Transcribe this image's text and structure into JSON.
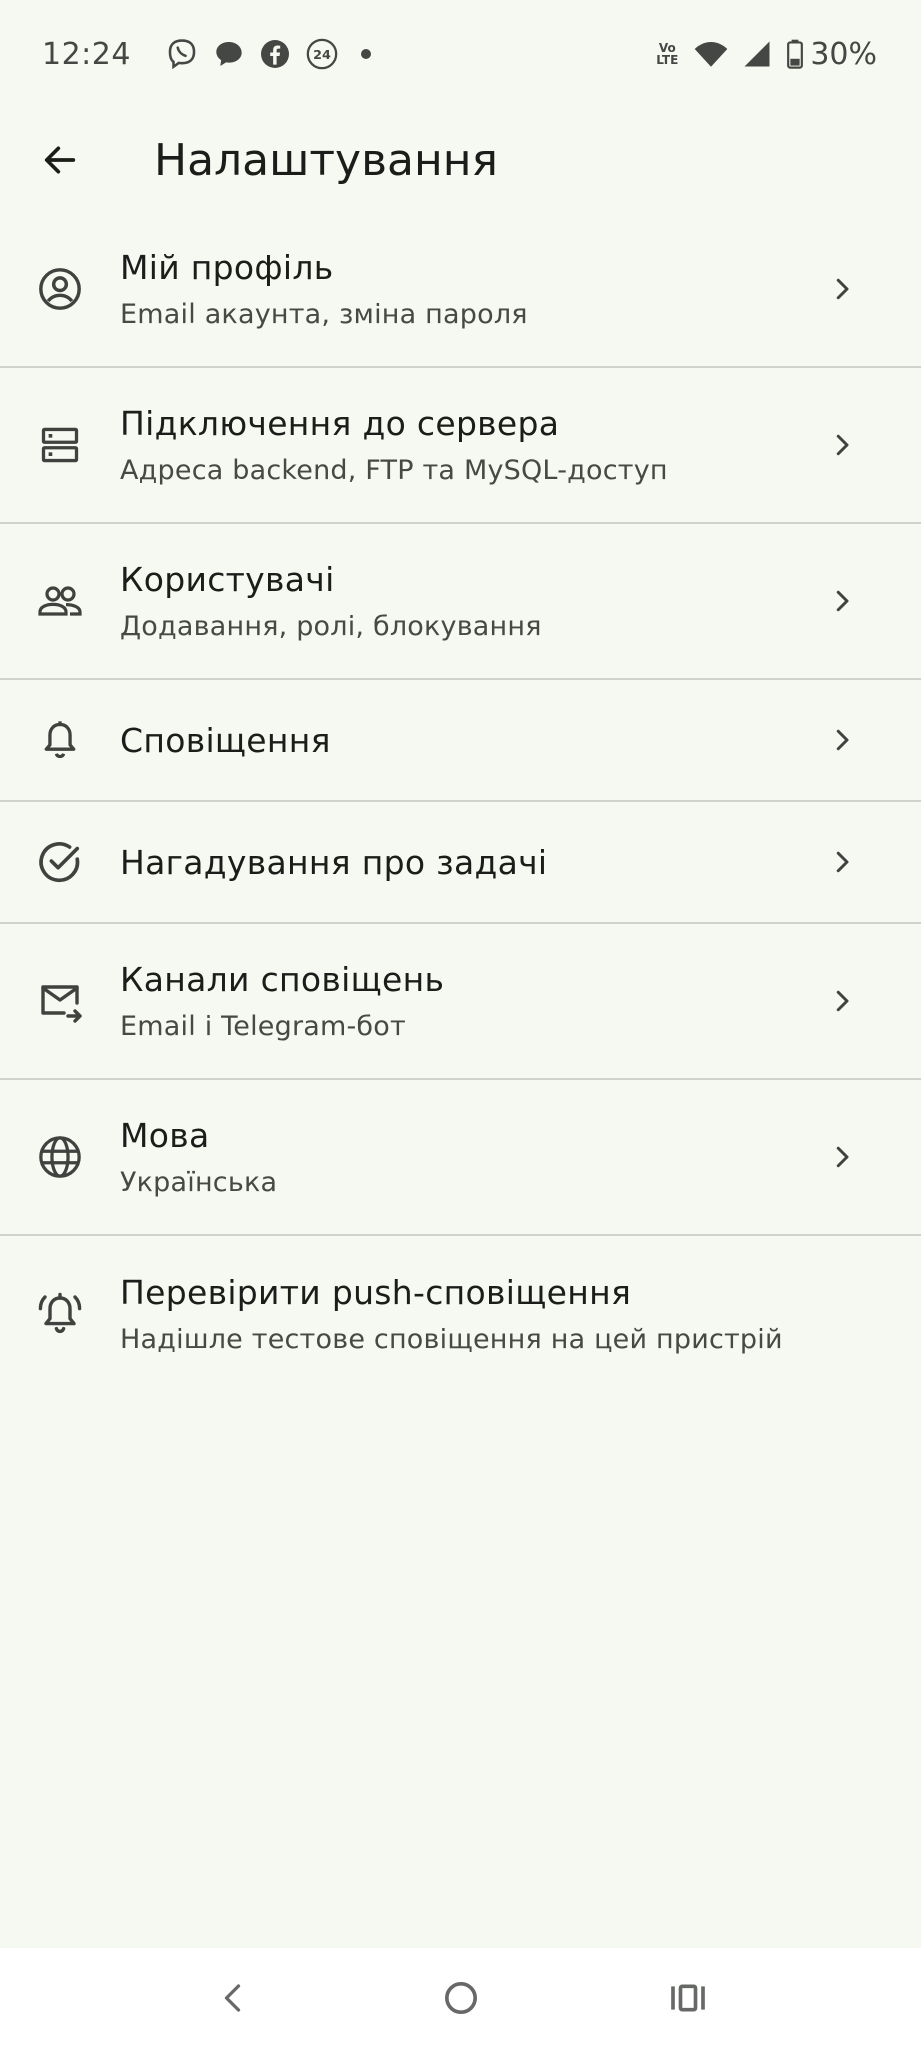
{
  "status_bar": {
    "time": "12:24",
    "notification_icons": [
      "viber-icon",
      "chat-bubble-icon",
      "facebook-icon",
      "24-badge-icon"
    ],
    "network_label_top": "Vo",
    "network_label_bottom": "LTE",
    "battery_percent": "30%"
  },
  "app_bar": {
    "title": "Налаштування"
  },
  "settings": {
    "items": [
      {
        "icon": "account-circle-icon",
        "title": "Мій профіль",
        "subtitle": "Email акаунта, зміна пароля"
      },
      {
        "icon": "server-icon",
        "title": "Підключення до сервера",
        "subtitle": "Адреса backend, FTP та MySQL-доступ"
      },
      {
        "icon": "people-icon",
        "title": "Користувачі",
        "subtitle": "Додавання, ролі, блокування"
      },
      {
        "icon": "bell-icon",
        "title": "Сповіщення",
        "subtitle": ""
      },
      {
        "icon": "check-circle-icon",
        "title": "Нагадування про задачі",
        "subtitle": ""
      },
      {
        "icon": "mail-forward-icon",
        "title": "Канали сповіщень",
        "subtitle": "Email і Telegram-бот"
      },
      {
        "icon": "globe-icon",
        "title": "Мова",
        "subtitle": "Українська"
      },
      {
        "icon": "bell-ring-icon",
        "title": "Перевірити push-сповіщення",
        "subtitle": "Надішле тестове сповіщення на цей пристрій"
      }
    ]
  },
  "colors": {
    "background": "#f6f9f1",
    "divider": "#cfd3cc",
    "text_primary": "#1b1d1a",
    "text_secondary": "#464944",
    "nav_bar": "#ffffff"
  }
}
